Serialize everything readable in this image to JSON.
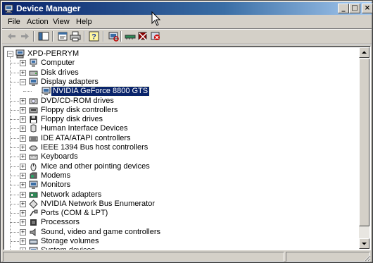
{
  "window": {
    "title": "Device Manager",
    "controls": {
      "minimize": "_",
      "maximize": "□",
      "close": "×"
    }
  },
  "menu": {
    "items": [
      "File",
      "Action",
      "View",
      "Help"
    ]
  },
  "toolbar": {
    "buttons": [
      "back-arrow-icon",
      "forward-arrow-icon",
      "show-hide-console-tree-icon",
      "properties-icon",
      "print-icon",
      "help-icon",
      "scan-hardware-icon",
      "update-driver-icon",
      "disable-device-icon",
      "uninstall-device-icon"
    ]
  },
  "tree": {
    "root": {
      "label": "XPD-PERRYM",
      "expander": "−"
    },
    "categories": [
      {
        "label": "Computer",
        "expander": "+",
        "icon": "computer-icon"
      },
      {
        "label": "Disk drives",
        "expander": "+",
        "icon": "disk-drive-icon"
      },
      {
        "label": "Display adapters",
        "expander": "−",
        "icon": "display-adapter-icon",
        "children": [
          {
            "label": "NVIDIA GeForce 8800 GTS",
            "selected": true,
            "icon": "display-adapter-icon"
          }
        ]
      },
      {
        "label": "DVD/CD-ROM drives",
        "expander": "+",
        "icon": "cdrom-icon"
      },
      {
        "label": "Floppy disk controllers",
        "expander": "+",
        "icon": "floppy-controller-icon"
      },
      {
        "label": "Floppy disk drives",
        "expander": "+",
        "icon": "floppy-drive-icon"
      },
      {
        "label": "Human Interface Devices",
        "expander": "+",
        "icon": "hid-icon"
      },
      {
        "label": "IDE ATA/ATAPI controllers",
        "expander": "+",
        "icon": "ide-controller-icon"
      },
      {
        "label": "IEEE 1394 Bus host controllers",
        "expander": "+",
        "icon": "ieee1394-icon"
      },
      {
        "label": "Keyboards",
        "expander": "+",
        "icon": "keyboard-icon"
      },
      {
        "label": "Mice and other pointing devices",
        "expander": "+",
        "icon": "mouse-icon"
      },
      {
        "label": "Modems",
        "expander": "+",
        "icon": "modem-icon"
      },
      {
        "label": "Monitors",
        "expander": "+",
        "icon": "monitor-icon"
      },
      {
        "label": "Network adapters",
        "expander": "+",
        "icon": "network-adapter-icon"
      },
      {
        "label": "NVIDIA Network Bus Enumerator",
        "expander": "+",
        "icon": "network-bus-icon"
      },
      {
        "label": "Ports (COM & LPT)",
        "expander": "+",
        "icon": "port-icon"
      },
      {
        "label": "Processors",
        "expander": "+",
        "icon": "processor-icon"
      },
      {
        "label": "Sound, video and game controllers",
        "expander": "+",
        "icon": "sound-icon"
      },
      {
        "label": "Storage volumes",
        "expander": "+",
        "icon": "storage-volume-icon"
      },
      {
        "label": "System devices",
        "expander": "+",
        "icon": "system-devices-icon"
      }
    ]
  },
  "scrollbar": {
    "up": "▲",
    "down": "▼",
    "position": 0
  },
  "colors": {
    "title_start": "#0a246a",
    "title_end": "#a6caf0",
    "selection": "#0a246a",
    "face": "#d4d0c8"
  }
}
